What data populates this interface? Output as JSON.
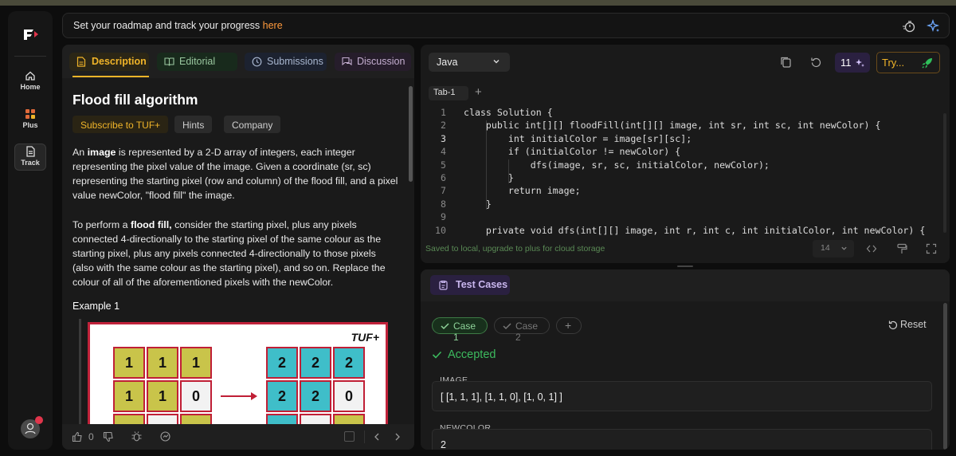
{
  "nav": {
    "logo": "F",
    "items": [
      {
        "label": "Home",
        "icon": "home-icon"
      },
      {
        "label": "Plus",
        "icon": "plus-grid-icon"
      },
      {
        "label": "Track",
        "icon": "track-icon"
      }
    ]
  },
  "topbar": {
    "message": "Set your roadmap and track your progress ",
    "link_text": "here"
  },
  "description": {
    "tabs": [
      "Description",
      "Editorial",
      "Submissions",
      "Discussion"
    ],
    "title": "Flood fill algorithm",
    "chips": [
      "Subscribe to TUF+",
      "Hints",
      "Company"
    ],
    "para1": {
      "t1": "An ",
      "b1": "image",
      "t2": " is represented by a 2-D array of integers, each integer representing the pixel value of the image. Given a coordinate (sr, sc) representing the starting pixel (row and column) of the flood fill, and a pixel value newColor, \"flood fill\" the image."
    },
    "para2": {
      "t1": "To perform a ",
      "b1": "flood fill,",
      "t2": " consider the starting pixel, plus any pixels connected 4-directionally to the starting pixel of the same colour as the starting pixel, plus any pixels connected 4-directionally to those pixels (also with the same colour as the starting pixel), and so on. Replace the colour of all of the aforementioned pixels with the newColor."
    },
    "example_label": "Example 1",
    "example_image": {
      "brand": "TUF+",
      "left_grid": [
        [
          "1",
          "1",
          "1"
        ],
        [
          "1",
          "1",
          "0"
        ]
      ],
      "right_grid": [
        [
          "2",
          "2",
          "2"
        ],
        [
          "2",
          "2",
          "0"
        ]
      ]
    },
    "footer": {
      "likes": "0"
    }
  },
  "editor": {
    "language": "Java",
    "ai_count": "11",
    "try_label": "Try...",
    "tab_label": "Tab-1",
    "lines": [
      "class Solution {",
      "    public int[][] floodFill(int[][] image, int sr, int sc, int newColor) {",
      "        int initialColor = image[sr][sc];",
      "        if (initialColor != newColor) {",
      "            dfs(image, sr, sc, initialColor, newColor);",
      "        }",
      "        return image;",
      "    }",
      "",
      "    private void dfs(int[][] image, int r, int c, int initialColor, int newColor) {"
    ],
    "line_numbers": [
      "1",
      "2",
      "3",
      "4",
      "5",
      "6",
      "7",
      "8",
      "9",
      "10"
    ],
    "saved_note": "Saved to local, upgrade to plus for cloud storage",
    "font_size": "14"
  },
  "testcases": {
    "header": "Test Cases",
    "cases": [
      "Case 1",
      "Case 2"
    ],
    "add": "+",
    "reset": "Reset",
    "status": "Accepted",
    "fields": [
      {
        "label": "IMAGE",
        "value": "[ [1, 1, 1], [1, 1, 0], [1, 0, 1] ]"
      },
      {
        "label": "NEWCOLOR",
        "value": "2"
      }
    ]
  },
  "colors": {
    "accent": "#f0b429",
    "accepted": "#3cba5e",
    "link": "#ff9a3c"
  }
}
